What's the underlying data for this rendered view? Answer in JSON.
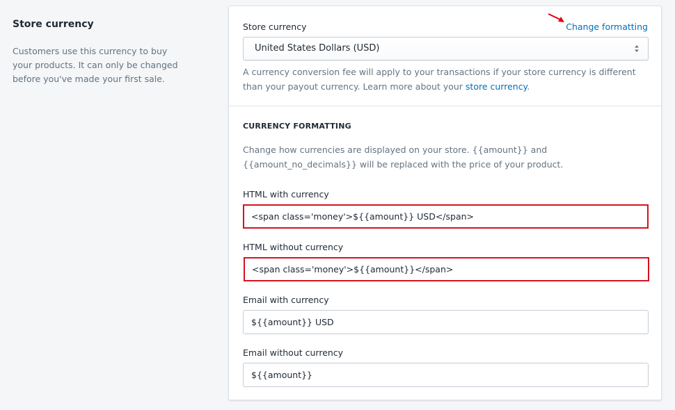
{
  "left": {
    "title": "Store currency",
    "description": "Customers use this currency to buy your products. It can only be changed before you've made your first sale."
  },
  "store_currency": {
    "label": "Store currency",
    "change_link": "Change formatting",
    "selected": "United States Dollars (USD)",
    "help_prefix": "A currency conversion fee will apply to your transactions if your store currency is different than your payout currency. Learn more about your ",
    "help_link": "store currency",
    "help_suffix": "."
  },
  "formatting": {
    "heading": "CURRENCY FORMATTING",
    "description": "Change how currencies are displayed on your store. {{amount}} and {{amount_no_decimals}} will be replaced with the price of your product.",
    "fields": [
      {
        "label": "HTML with currency",
        "value": "<span class='money'>${{amount}} USD</span>"
      },
      {
        "label": "HTML without currency",
        "value": "<span class='money'>${{amount}}</span>"
      },
      {
        "label": "Email with currency",
        "value": "${{amount}} USD"
      },
      {
        "label": "Email without currency",
        "value": "${{amount}}"
      }
    ]
  },
  "colors": {
    "link": "#006fbb",
    "highlight": "#d5121f"
  }
}
